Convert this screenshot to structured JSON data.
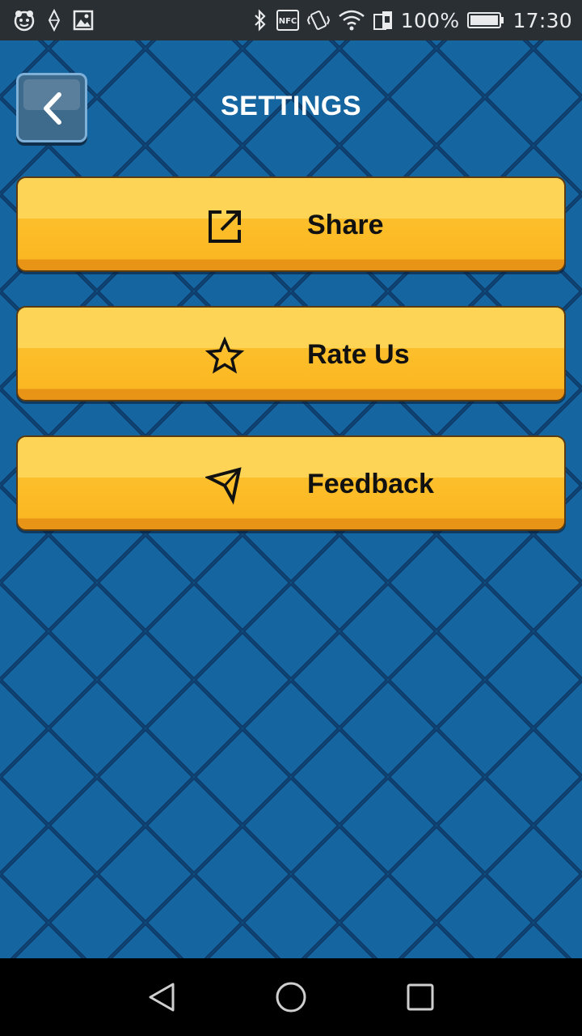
{
  "status_bar": {
    "battery_percent": "100%",
    "time": "17:30",
    "nfc_label": "NFC",
    "icons": [
      "face-notification-icon",
      "diamond-notification-icon",
      "image-notification-icon",
      "bluetooth-icon",
      "nfc-icon",
      "vibrate-icon",
      "wifi-icon",
      "sim-icon",
      "battery-icon"
    ]
  },
  "header": {
    "title": "SETTINGS",
    "back_icon": "chevron-left-icon"
  },
  "menu": {
    "items": [
      {
        "label": "Share",
        "icon": "share-icon"
      },
      {
        "label": "Rate Us",
        "icon": "star-icon"
      },
      {
        "label": "Feedback",
        "icon": "send-icon"
      }
    ]
  },
  "nav_bar": {
    "icons": [
      "back-triangle-icon",
      "home-circle-icon",
      "recents-square-icon"
    ]
  },
  "colors": {
    "background": "#135c92",
    "button": "#fcbf2b",
    "button_highlight": "#fdd455",
    "status_bar": "#2a2f33"
  }
}
